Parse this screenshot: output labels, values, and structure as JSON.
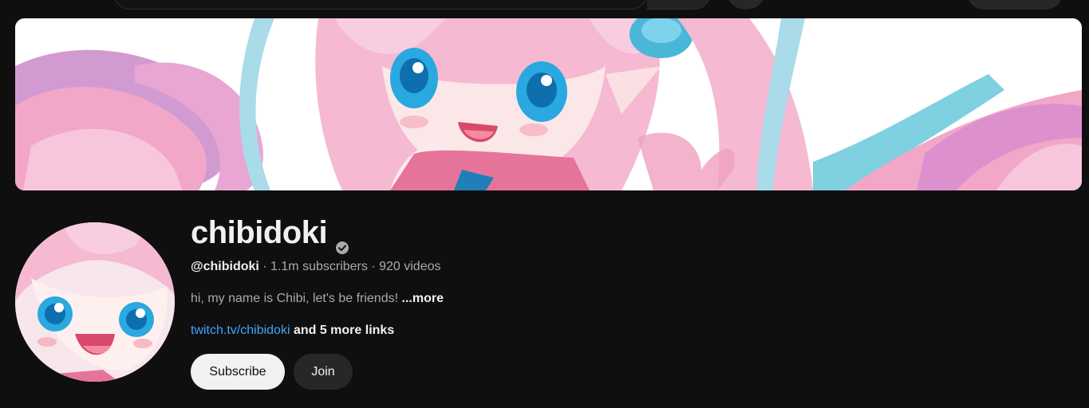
{
  "channel": {
    "name": "chibidoki",
    "handle": "@chibidoki",
    "sep1": " · ",
    "subscribers": "1.1m subscribers",
    "sep2": " · ",
    "videos": "920 videos",
    "description": "hi, my name is Chibi, let's be friends! ",
    "more_label": "...more",
    "link": "twitch.tv/chibidoki",
    "more_links": " and 5 more links"
  },
  "buttons": {
    "subscribe": "Subscribe",
    "join": "Join"
  },
  "icons": {
    "verified": "verified-check-icon",
    "search": "search-icon",
    "mic": "mic-icon"
  },
  "colors": {
    "background": "#0f0f0f",
    "link": "#3ea6ff",
    "text_primary": "#f1f1f1",
    "text_secondary": "#aaaaaa",
    "subscribe_bg": "#f1f1f1",
    "join_bg": "#272727"
  }
}
